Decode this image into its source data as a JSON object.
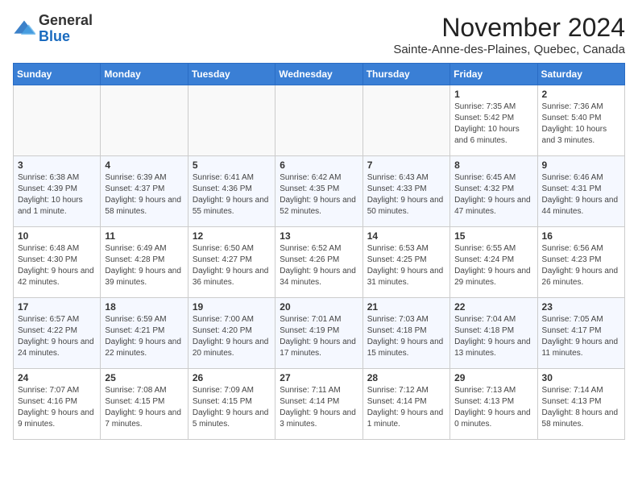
{
  "header": {
    "logo_general": "General",
    "logo_blue": "Blue",
    "month_title": "November 2024",
    "location": "Sainte-Anne-des-Plaines, Quebec, Canada"
  },
  "days_of_week": [
    "Sunday",
    "Monday",
    "Tuesday",
    "Wednesday",
    "Thursday",
    "Friday",
    "Saturday"
  ],
  "weeks": [
    [
      {
        "day": "",
        "info": ""
      },
      {
        "day": "",
        "info": ""
      },
      {
        "day": "",
        "info": ""
      },
      {
        "day": "",
        "info": ""
      },
      {
        "day": "",
        "info": ""
      },
      {
        "day": "1",
        "info": "Sunrise: 7:35 AM\nSunset: 5:42 PM\nDaylight: 10 hours and 6 minutes."
      },
      {
        "day": "2",
        "info": "Sunrise: 7:36 AM\nSunset: 5:40 PM\nDaylight: 10 hours and 3 minutes."
      }
    ],
    [
      {
        "day": "3",
        "info": "Sunrise: 6:38 AM\nSunset: 4:39 PM\nDaylight: 10 hours and 1 minute."
      },
      {
        "day": "4",
        "info": "Sunrise: 6:39 AM\nSunset: 4:37 PM\nDaylight: 9 hours and 58 minutes."
      },
      {
        "day": "5",
        "info": "Sunrise: 6:41 AM\nSunset: 4:36 PM\nDaylight: 9 hours and 55 minutes."
      },
      {
        "day": "6",
        "info": "Sunrise: 6:42 AM\nSunset: 4:35 PM\nDaylight: 9 hours and 52 minutes."
      },
      {
        "day": "7",
        "info": "Sunrise: 6:43 AM\nSunset: 4:33 PM\nDaylight: 9 hours and 50 minutes."
      },
      {
        "day": "8",
        "info": "Sunrise: 6:45 AM\nSunset: 4:32 PM\nDaylight: 9 hours and 47 minutes."
      },
      {
        "day": "9",
        "info": "Sunrise: 6:46 AM\nSunset: 4:31 PM\nDaylight: 9 hours and 44 minutes."
      }
    ],
    [
      {
        "day": "10",
        "info": "Sunrise: 6:48 AM\nSunset: 4:30 PM\nDaylight: 9 hours and 42 minutes."
      },
      {
        "day": "11",
        "info": "Sunrise: 6:49 AM\nSunset: 4:28 PM\nDaylight: 9 hours and 39 minutes."
      },
      {
        "day": "12",
        "info": "Sunrise: 6:50 AM\nSunset: 4:27 PM\nDaylight: 9 hours and 36 minutes."
      },
      {
        "day": "13",
        "info": "Sunrise: 6:52 AM\nSunset: 4:26 PM\nDaylight: 9 hours and 34 minutes."
      },
      {
        "day": "14",
        "info": "Sunrise: 6:53 AM\nSunset: 4:25 PM\nDaylight: 9 hours and 31 minutes."
      },
      {
        "day": "15",
        "info": "Sunrise: 6:55 AM\nSunset: 4:24 PM\nDaylight: 9 hours and 29 minutes."
      },
      {
        "day": "16",
        "info": "Sunrise: 6:56 AM\nSunset: 4:23 PM\nDaylight: 9 hours and 26 minutes."
      }
    ],
    [
      {
        "day": "17",
        "info": "Sunrise: 6:57 AM\nSunset: 4:22 PM\nDaylight: 9 hours and 24 minutes."
      },
      {
        "day": "18",
        "info": "Sunrise: 6:59 AM\nSunset: 4:21 PM\nDaylight: 9 hours and 22 minutes."
      },
      {
        "day": "19",
        "info": "Sunrise: 7:00 AM\nSunset: 4:20 PM\nDaylight: 9 hours and 20 minutes."
      },
      {
        "day": "20",
        "info": "Sunrise: 7:01 AM\nSunset: 4:19 PM\nDaylight: 9 hours and 17 minutes."
      },
      {
        "day": "21",
        "info": "Sunrise: 7:03 AM\nSunset: 4:18 PM\nDaylight: 9 hours and 15 minutes."
      },
      {
        "day": "22",
        "info": "Sunrise: 7:04 AM\nSunset: 4:18 PM\nDaylight: 9 hours and 13 minutes."
      },
      {
        "day": "23",
        "info": "Sunrise: 7:05 AM\nSunset: 4:17 PM\nDaylight: 9 hours and 11 minutes."
      }
    ],
    [
      {
        "day": "24",
        "info": "Sunrise: 7:07 AM\nSunset: 4:16 PM\nDaylight: 9 hours and 9 minutes."
      },
      {
        "day": "25",
        "info": "Sunrise: 7:08 AM\nSunset: 4:15 PM\nDaylight: 9 hours and 7 minutes."
      },
      {
        "day": "26",
        "info": "Sunrise: 7:09 AM\nSunset: 4:15 PM\nDaylight: 9 hours and 5 minutes."
      },
      {
        "day": "27",
        "info": "Sunrise: 7:11 AM\nSunset: 4:14 PM\nDaylight: 9 hours and 3 minutes."
      },
      {
        "day": "28",
        "info": "Sunrise: 7:12 AM\nSunset: 4:14 PM\nDaylight: 9 hours and 1 minute."
      },
      {
        "day": "29",
        "info": "Sunrise: 7:13 AM\nSunset: 4:13 PM\nDaylight: 9 hours and 0 minutes."
      },
      {
        "day": "30",
        "info": "Sunrise: 7:14 AM\nSunset: 4:13 PM\nDaylight: 8 hours and 58 minutes."
      }
    ]
  ]
}
